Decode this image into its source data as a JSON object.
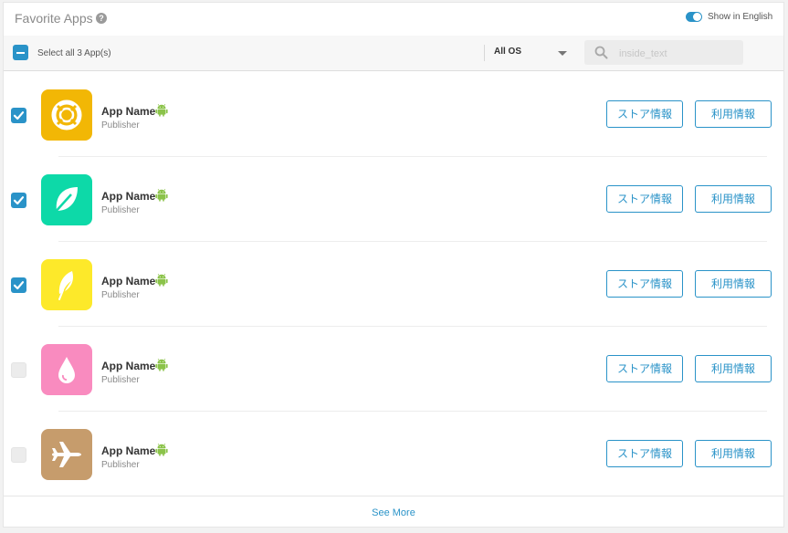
{
  "header": {
    "title": "Favorite Apps",
    "help_icon": "question-circle-icon",
    "toggle_label": "Show in English",
    "toggle_on": true
  },
  "toolbar": {
    "select_all_label": "Select all 3 App(s)",
    "os_selected": "All OS",
    "search_placeholder": "inside_text",
    "search_value": ""
  },
  "apps": [
    {
      "name": "App Name",
      "publisher": "Publisher",
      "checked": true,
      "icon": "lifebuoy-icon",
      "icon_bg": "#f2b705",
      "platform_icon": "android-icon",
      "store_label": "ストア情報",
      "usage_label": "利用情報"
    },
    {
      "name": "App Name",
      "publisher": "Publisher",
      "checked": true,
      "icon": "leaf-icon",
      "icon_bg": "#0dd9a8",
      "platform_icon": "android-icon",
      "store_label": "ストア情報",
      "usage_label": "利用情報"
    },
    {
      "name": "App Name",
      "publisher": "Publisher",
      "checked": true,
      "icon": "feather-icon",
      "icon_bg": "#fde92a",
      "platform_icon": "android-icon",
      "store_label": "ストア情報",
      "usage_label": "利用情報"
    },
    {
      "name": "App Name",
      "publisher": "Publisher",
      "checked": false,
      "icon": "water-drop-icon",
      "icon_bg": "#f98bbf",
      "platform_icon": "android-icon",
      "store_label": "ストア情報",
      "usage_label": "利用情報"
    },
    {
      "name": "App Name",
      "publisher": "Publisher",
      "checked": false,
      "icon": "airplane-icon",
      "icon_bg": "#c69c6c",
      "platform_icon": "android-icon",
      "store_label": "ストア情報",
      "usage_label": "利用情報"
    }
  ],
  "footer": {
    "see_more_label": "See More"
  },
  "colors": {
    "accent": "#2a93c8",
    "android": "#8bc34a"
  }
}
